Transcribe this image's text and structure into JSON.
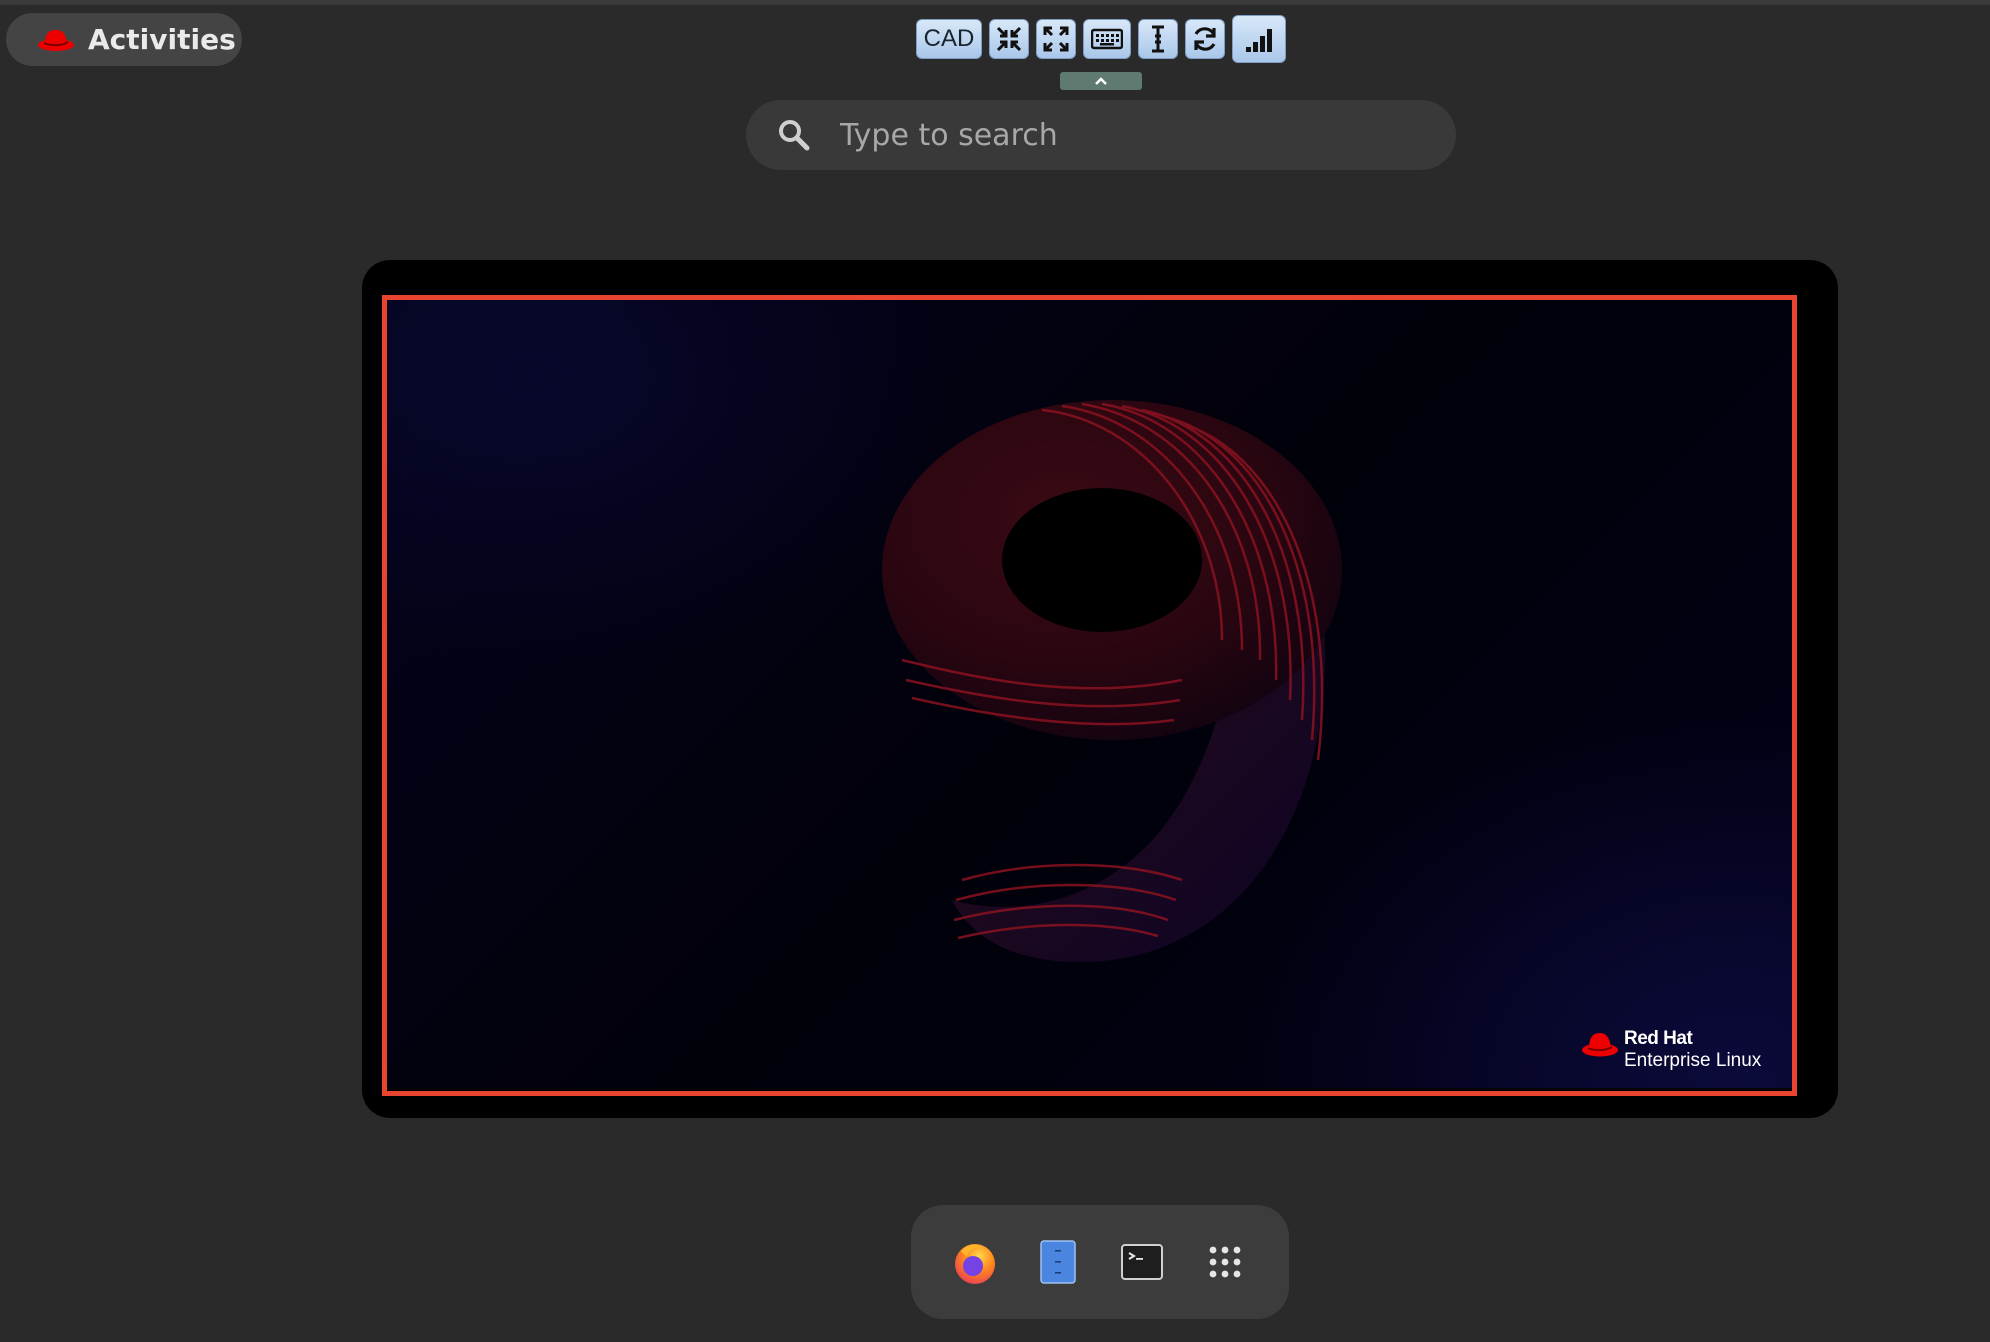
{
  "topbar": {
    "activities_label": "Activities",
    "activities_icon": "red-hat-icon"
  },
  "remote_toolbar": {
    "buttons": [
      {
        "label": "CAD",
        "icon": "ctrl-alt-del-icon"
      },
      {
        "label": "",
        "icon": "exit-fullscreen-icon"
      },
      {
        "label": "",
        "icon": "fullscreen-icon"
      },
      {
        "label": "",
        "icon": "keyboard-icon"
      },
      {
        "label": "",
        "icon": "text-cursor-icon"
      },
      {
        "label": "",
        "icon": "refresh-icon"
      },
      {
        "label": "",
        "icon": "signal-strength-icon"
      }
    ],
    "handle_icon": "chevron-up-icon",
    "accent_color": "#a9c7ea"
  },
  "search": {
    "placeholder": "Type to search",
    "value": ""
  },
  "workspace": {
    "wallpaper_brand": "Red Hat",
    "wallpaper_product": "Enterprise Linux",
    "selection_color": "#e8442f"
  },
  "dash": {
    "items": [
      {
        "name": "Firefox",
        "icon": "firefox-icon"
      },
      {
        "name": "Files",
        "icon": "files-icon"
      },
      {
        "name": "Terminal",
        "icon": "terminal-icon"
      },
      {
        "name": "Show Applications",
        "icon": "app-grid-icon"
      }
    ]
  }
}
